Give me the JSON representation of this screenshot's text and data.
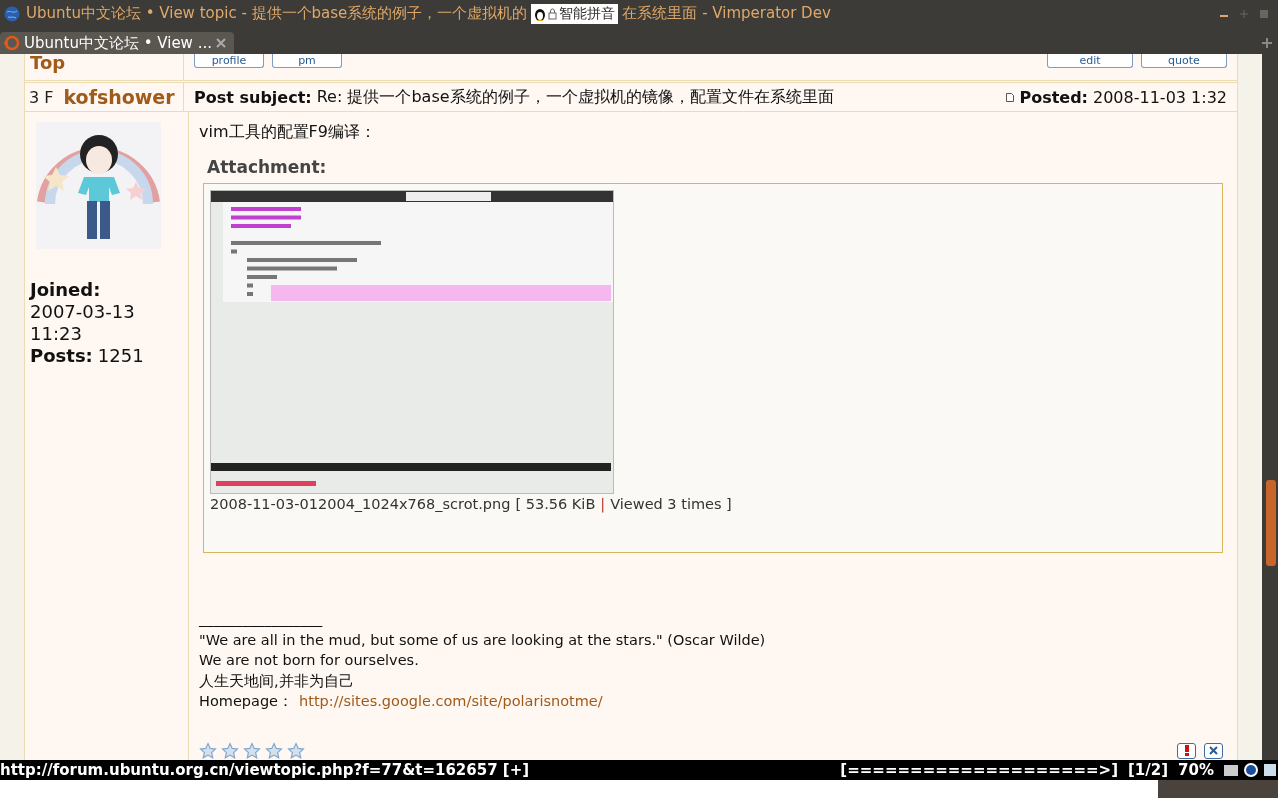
{
  "window": {
    "title_start": "Ubuntu中文论坛 • View topic - 提供一个base系统的例子，一个虚拟机的",
    "title_end": "在系统里面 - Vimperator Dev"
  },
  "ime_popup": {
    "label": "智能拼音"
  },
  "tabs": [
    {
      "label": "Ubuntu中文论坛 • View ...",
      "selected": true
    }
  ],
  "previous_post": {
    "top_link": "Top",
    "buttons": [
      "profile",
      "pm"
    ],
    "actions": [
      "edit",
      "quote"
    ]
  },
  "post": {
    "number": "3 F",
    "author": "kofshower",
    "subject_label": "Post subject:",
    "subject": "Re: 提供一个base系统的例子，一个虚拟机的镜像，配置文件在系统里面",
    "posted_label": "Posted:",
    "posted": "2008-11-03 1:32",
    "profile": {
      "joined_label": "Joined:",
      "joined_date": "2007-03-13",
      "joined_time": "11:23",
      "posts_label": "Posts:",
      "posts": "1251"
    },
    "body": "vim工具的配置F9编译：",
    "attachment": {
      "heading": "Attachment:",
      "file": "2008-11-03-012004_1024x768_scrot.png",
      "size": "[ 53.56 KiB",
      "separator": "|",
      "views": "Viewed 3 times ]"
    },
    "signature": {
      "rule": "_________________",
      "lines": [
        "\"We are all in the mud, but some of us are looking at the stars.\" (Oscar Wilde)",
        "We are not born for ourselves.",
        "人生天地间,并非为自己"
      ],
      "homepage_label": "Homepage：",
      "homepage_link": "http://sites.google.com/site/polarisnotme/"
    },
    "rating": {
      "stars": 0
    }
  },
  "status_bar": {
    "url": "http://forum.ubuntu.org.cn/viewtopic.php?f=77&t=162657 [+]",
    "progress": "[====================>]",
    "tab_index": "[1/2]",
    "zoom": "70%"
  }
}
